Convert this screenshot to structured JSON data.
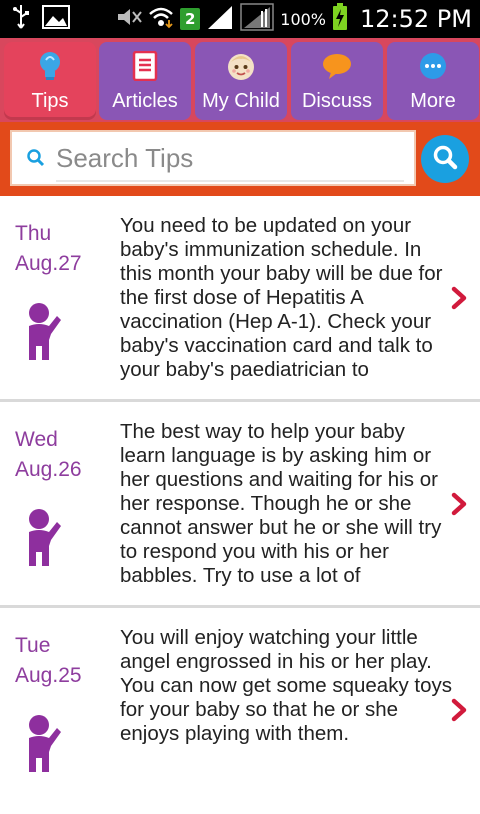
{
  "status_bar": {
    "signal_badge": "2",
    "battery_percent": "100%",
    "time": "12:52 PM"
  },
  "tabs": [
    {
      "label": "Tips",
      "icon": "lightbulb-icon",
      "active": true
    },
    {
      "label": "Articles",
      "icon": "article-icon",
      "active": false
    },
    {
      "label": "My Child",
      "icon": "baby-face-icon",
      "active": false
    },
    {
      "label": "Discuss",
      "icon": "chat-bubble-icon",
      "active": false
    },
    {
      "label": "More",
      "icon": "more-dots-icon",
      "active": false
    }
  ],
  "search": {
    "placeholder": "Search Tips",
    "value": ""
  },
  "tips": [
    {
      "day": "Thu",
      "date": "Aug.27",
      "text": "You need to be updated on your baby's immunization schedule. In this month your baby will be due for the first dose of Hepatitis A vaccination (Hep A-1). Check your baby's vaccination card and talk to your baby's paediatrician to"
    },
    {
      "day": "Wed",
      "date": "Aug.26",
      "text": "The best way to help your baby learn language is by asking him or her questions and waiting for his or her response. Though he or she cannot answer but he or she will try to respond you with his or her babbles. Try to use a lot of"
    },
    {
      "day": "Tue",
      "date": "Aug.25",
      "text": "You will enjoy watching your little angel engrossed in his or her play. You can now get some squeaky toys for your baby so that he or she enjoys playing with them."
    }
  ],
  "colors": {
    "tab_bar": "#d8475d",
    "tab": "#8a56b5",
    "tab_active": "#e4435c",
    "search_bar": "#e24a1a",
    "search_button": "#1aa0e0",
    "date_text": "#8e3d9e",
    "child_icon": "#8e2f9e",
    "chevron": "#d11a3c"
  }
}
